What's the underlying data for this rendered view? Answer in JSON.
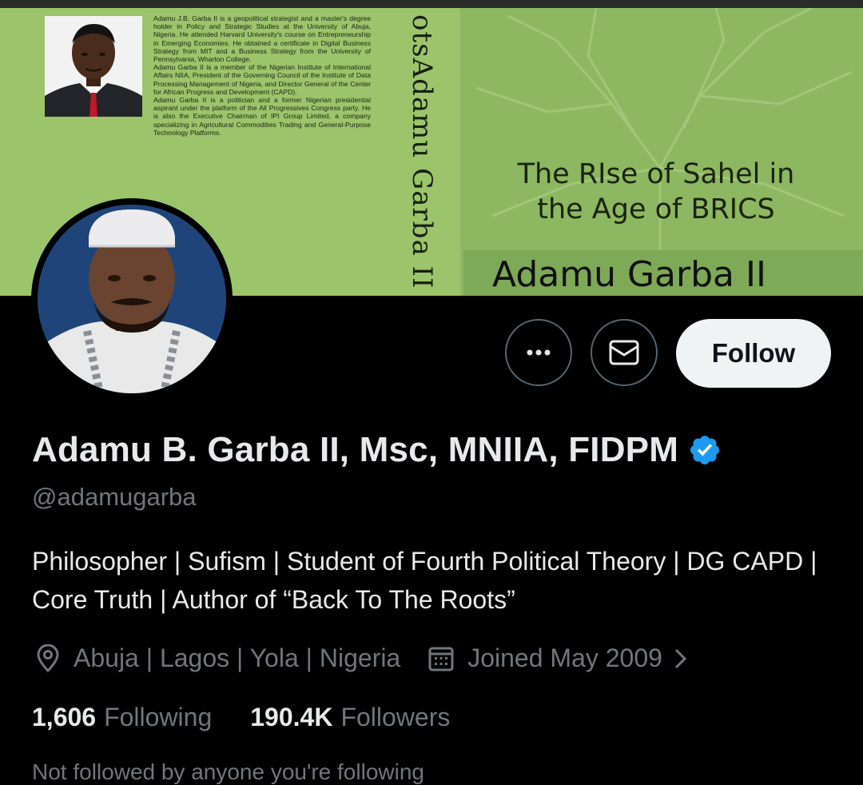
{
  "banner": {
    "back_cover_bio": [
      "Adamu J.B. Garba II is a geopolitical strategist and a master's degree holder in Policy and Strategic Studies at the University of Abuja, Nigeria. He attended Harvard University's course on Entrepreneurship in Emerging Economies. He obtained a certificate in Digital Business Strategy from MIT and a Business Strategy from the University of Pennsylvania, Wharton College.",
      "Adamu Garba II is a member of the Nigerian Institute of International Affairs NIIA, President of the Governing Council of the Institute of Data Processing Management of Nigeria, and Director General of the Center for African Progress and Development (CAPD).",
      "Adamu Garba II is a politician and a former Nigerian presidential aspirant under the platform of the All Progressives Congress party. He is also the Executive Chairman of IPI Group Limited, a company specializing in Agricultural Commodities Trading and General-Purpose Technology Platforms."
    ],
    "spine_text": "otsAdamu Garba II",
    "book_title_line1": "The RIse of Sahel in",
    "book_title_line2": "the Age of BRICS",
    "book_author": "Adamu Garba II",
    "colors": {
      "cover": "#9bc46b",
      "front": "#8db760"
    }
  },
  "actions": {
    "more_icon": "more-horizontal-icon",
    "message_icon": "envelope-icon",
    "follow_label": "Follow"
  },
  "profile": {
    "name": "Adamu B. Garba II, Msc, MNIIA, FIDPM",
    "verified_icon": "verified-badge-icon",
    "verified_color": "#1d9bf0",
    "handle": "@adamugarba",
    "bio": "Philosopher | Sufism | Student of Fourth Political Theory | DG CAPD | Core Truth | Author of “Back To The Roots”",
    "location": "Abuja | Lagos | Yola | Nigeria",
    "joined": "Joined May 2009",
    "following_count": "1,606",
    "following_label": "Following",
    "followers_count": "190.4K",
    "followers_label": "Followers",
    "followed_by_partial": "Not followed by anyone you're following"
  }
}
